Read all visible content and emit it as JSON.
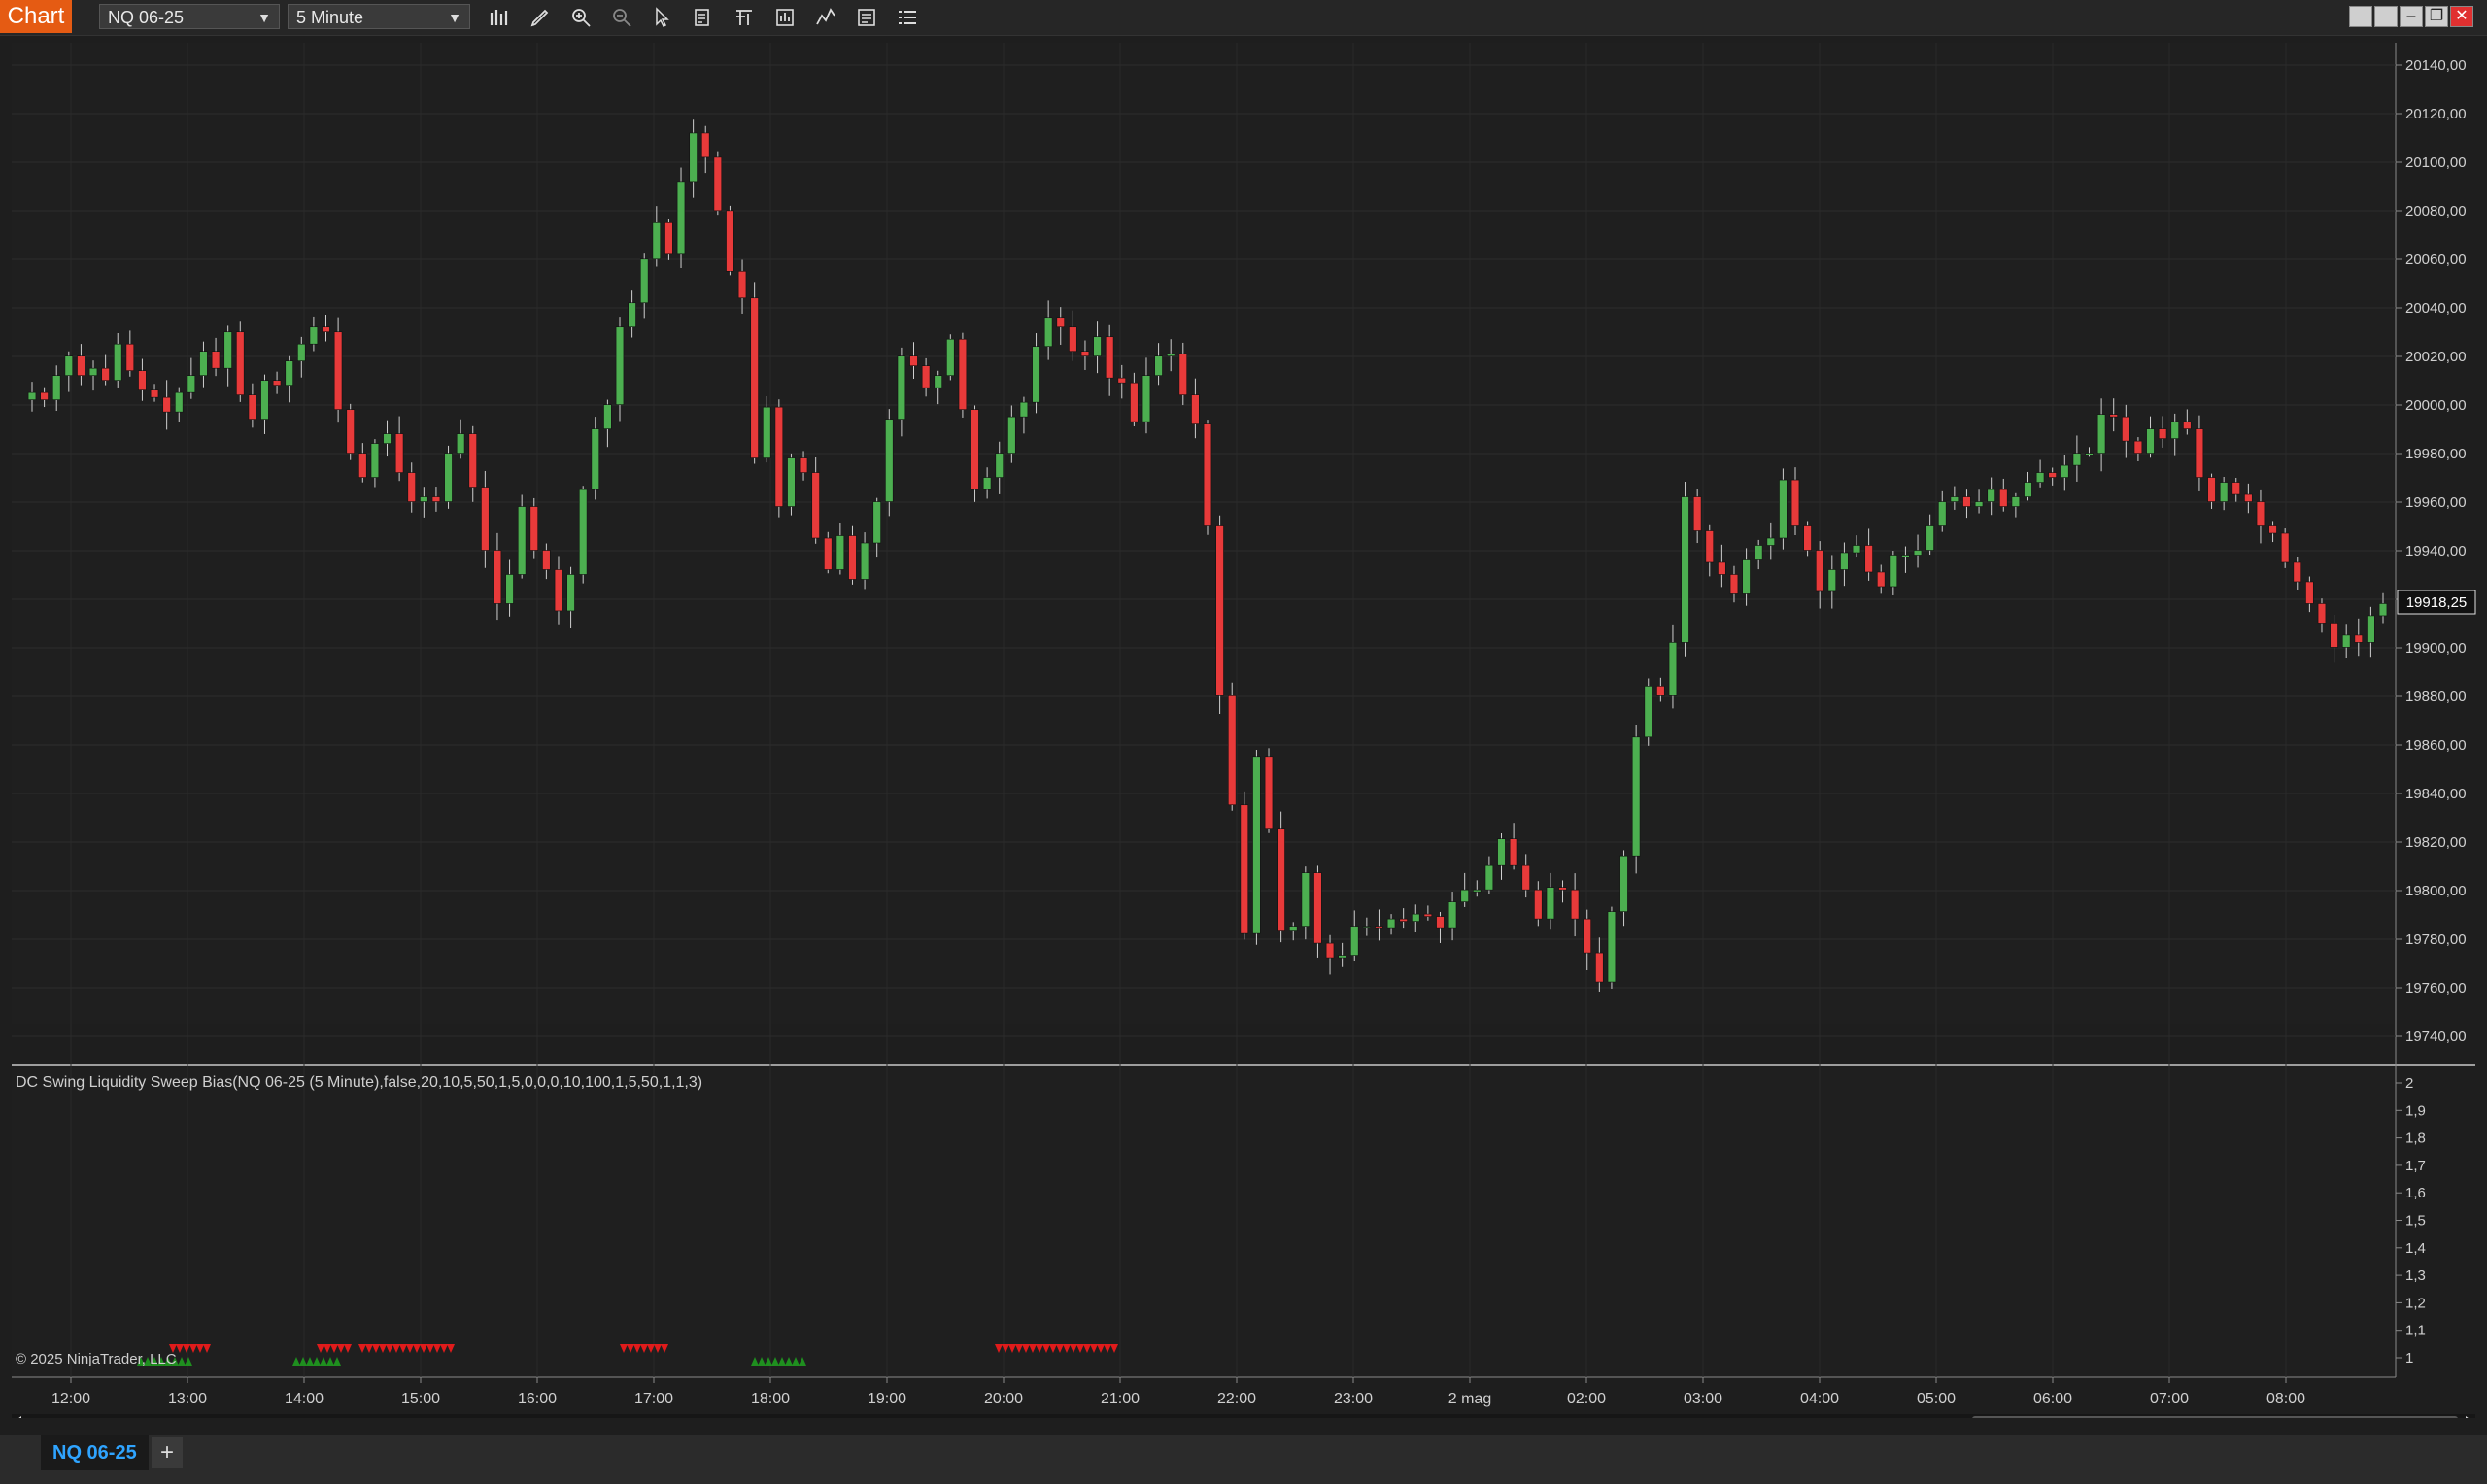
{
  "toolbar": {
    "chart_tab": "Chart",
    "instrument": "NQ 06-25",
    "interval": "5 Minute",
    "tools": [
      "bar-chart-icon",
      "draw-pencil-icon",
      "zoom-in-icon",
      "zoom-out-icon",
      "pointer-icon",
      "data-box-icon",
      "properties-icon",
      "strategies-icon",
      "indicators-icon",
      "templates-icon",
      "list-icon"
    ]
  },
  "window_controls": [
    "tile-icon",
    "tile-icon-2",
    "minimize-icon",
    "restore-icon",
    "close-icon"
  ],
  "price_panel": {
    "y_ticks": [
      "20140,00",
      "20120,00",
      "20100,00",
      "20080,00",
      "20060,00",
      "20040,00",
      "20020,00",
      "20000,00",
      "19980,00",
      "19960,00",
      "19940,00",
      "19920,00",
      "19900,00",
      "19880,00",
      "19860,00",
      "19840,00",
      "19820,00",
      "19800,00",
      "19780,00",
      "19760,00",
      "19740,00"
    ],
    "last_price": "19918,25"
  },
  "indicator_panel": {
    "title": "DC Swing Liquidity Sweep Bias(NQ 06-25 (5 Minute),false,20,10,5,50,1,5,0,0,0,10,100,1,5,50,1,1,3)",
    "y_ticks": [
      "2",
      "1,9",
      "1,8",
      "1,7",
      "1,6",
      "1,5",
      "1,4",
      "1,3",
      "1,2",
      "1,1",
      "1"
    ],
    "copyright": "© 2025 NinjaTrader, LLC"
  },
  "x_ticks": [
    "12:00",
    "13:00",
    "14:00",
    "15:00",
    "16:00",
    "17:00",
    "18:00",
    "19:00",
    "20:00",
    "21:00",
    "22:00",
    "23:00",
    "2 mag",
    "02:00",
    "03:00",
    "04:00",
    "05:00",
    "06:00",
    "07:00",
    "08:00"
  ],
  "colors": {
    "up": "#4caf50",
    "down": "#e83a3a",
    "up_marker": "#1f8f1f",
    "down_marker": "#e01b1b"
  },
  "chart_data": {
    "type": "candlestick",
    "title": "",
    "y_range": [
      19730,
      20150
    ],
    "closes": [
      20005,
      20002,
      20012,
      20020,
      20012,
      20015,
      20010,
      20025,
      20014,
      20006,
      20003,
      19997,
      20005,
      20012,
      20022,
      20015,
      20030,
      20004,
      19994,
      20010,
      20008,
      20018,
      20025,
      20032,
      20030,
      19998,
      19980,
      19970,
      19984,
      19988,
      19972,
      19960,
      19962,
      19960,
      19980,
      19988,
      19966,
      19940,
      19918,
      19930,
      19958,
      19940,
      19932,
      19915,
      19930,
      19965,
      19990,
      20000,
      20032,
      20042,
      20060,
      20075,
      20062,
      20092,
      20112,
      20102,
      20080,
      20055,
      20044,
      19978,
      19999,
      19958,
      19978,
      19972,
      19945,
      19932,
      19946,
      19928,
      19943,
      19960,
      19994,
      20020,
      20016,
      20007,
      20012,
      20027,
      19998,
      19965,
      19970,
      19980,
      19995,
      20001,
      20024,
      20036,
      20032,
      20022,
      20020,
      20028,
      20011,
      20009,
      19993,
      20012,
      20020,
      20021,
      20004,
      19992,
      19950,
      19880,
      19835,
      19782,
      19855,
      19825,
      19783,
      19785,
      19807,
      19778,
      19772,
      19773,
      19785,
      19785,
      19784,
      19788,
      19787,
      19790,
      19789,
      19784,
      19795,
      19800,
      19800,
      19810,
      19821,
      19810,
      19800,
      19788,
      19801,
      19800,
      19788,
      19774,
      19762,
      19791,
      19814,
      19863,
      19884,
      19880,
      19902,
      19962,
      19948,
      19935,
      19930,
      19922,
      19936,
      19942,
      19945,
      19969,
      19950,
      19940,
      19923,
      19932,
      19939,
      19942,
      19931,
      19925,
      19938,
      19938,
      19940,
      19950,
      19960,
      19962,
      19958,
      19960,
      19965,
      19958,
      19962,
      19968,
      19972,
      19970,
      19975,
      19980,
      19980,
      19996,
      19995,
      19985,
      19980,
      19990,
      19986,
      19993,
      19990,
      19970,
      19960,
      19968,
      19963,
      19960,
      19950,
      19947,
      19935,
      19927,
      19918,
      19910,
      19900,
      19905,
      19902,
      19913,
      19918
    ],
    "up_markers": [
      [
        145,
        200
      ],
      [
        305,
        352
      ],
      [
        777,
        829
      ]
    ],
    "down_markers": [
      [
        178,
        218
      ],
      [
        330,
        358
      ],
      [
        373,
        468
      ],
      [
        642,
        689
      ],
      [
        1028,
        1149
      ]
    ],
    "indicator_range": [
      1,
      2
    ]
  }
}
